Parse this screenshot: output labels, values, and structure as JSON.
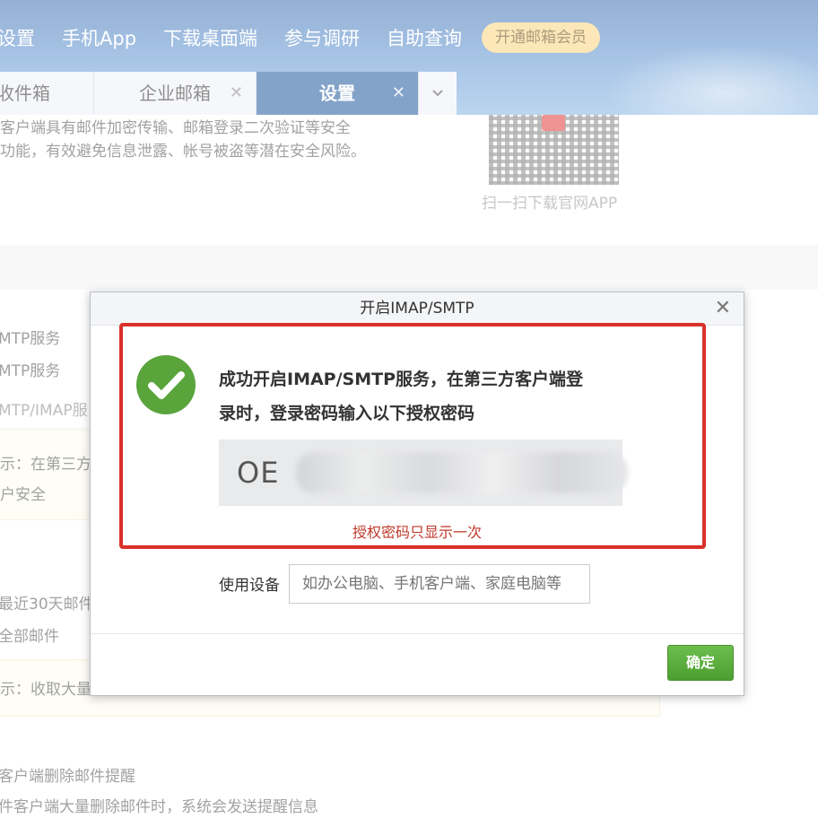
{
  "nav": {
    "settings": "设置",
    "mobile_app": "手机App",
    "download_desktop": "下载桌面端",
    "survey": "参与调研",
    "self_service": "自助查询",
    "vip": "开通邮箱会员"
  },
  "tabs": {
    "inbox": "收件箱",
    "enterprise": "企业邮箱",
    "settings": "设置"
  },
  "background": {
    "intro_line1": "客户端具有邮件加密传输、邮箱登录二次验证等安全",
    "intro_line2": "功能，有效避免信息泄露、帐号被盗等潜在安全风险。",
    "qr_caption": "扫一扫下载官网APP",
    "svc1": "MTP服务",
    "svc2": "MTP服务",
    "svc3": "MTP/IMAP服",
    "tip1_a": "示：在第三方",
    "tip1_b": "户安全",
    "recent": "最近30天邮件",
    "all_mail": "全部邮件",
    "tip2": "示：收取大量",
    "delete_title": "客户端删除邮件提醒",
    "delete_desc": "件客户端大量删除邮件时，系统会发送提醒信息"
  },
  "dialog": {
    "title": "开启IMAP/SMTP",
    "message_line1": "成功开启IMAP/SMTP服务，在第三方客户端登",
    "message_line2": "录时，登录密码输入以下授权密码",
    "password_visible": "OE",
    "password_once": "授权密码只显示一次",
    "device_label": "使用设备",
    "device_placeholder": "如办公电脑、手机客户端、家庭电脑等",
    "ok": "确定"
  },
  "colors": {
    "header_blue": "#3d6fb0",
    "active_tab": "#20589c",
    "vip_yellow": "#f7d47c",
    "alert_red": "#d9302a",
    "success_green": "#5aa43c"
  },
  "icons": [
    "close-icon",
    "chevron-down-icon",
    "check-icon",
    "qr-code"
  ]
}
